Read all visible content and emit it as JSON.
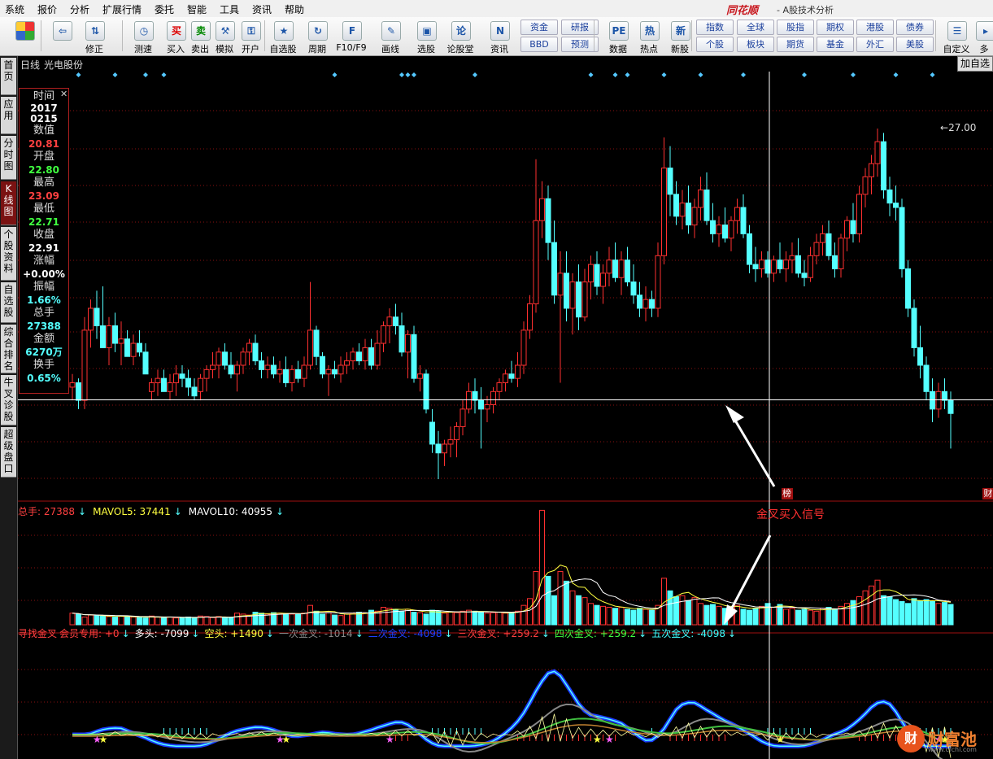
{
  "menu": [
    "系统",
    "报价",
    "分析",
    "扩展行情",
    "委托",
    "智能",
    "工具",
    "资讯",
    "帮助"
  ],
  "brand": "同花顺",
  "app_title": "- A股技术分析",
  "toolbar": {
    "buttons": [
      {
        "label": "",
        "icon": "home-icon",
        "glyph": "■"
      },
      {
        "label": "",
        "icon": "back-arrow-icon",
        "glyph": "⇦"
      },
      {
        "label": "修正",
        "icon": "updown-arrow-icon",
        "glyph": "⇅"
      },
      {
        "label": "测速",
        "icon": "clock-icon",
        "glyph": "◷"
      },
      {
        "label": "买入",
        "icon": "buy-icon",
        "glyph": "买"
      },
      {
        "label": "卖出",
        "icon": "sell-icon",
        "glyph": "卖"
      },
      {
        "label": "模拟",
        "icon": "hammer-icon",
        "glyph": "⚒"
      },
      {
        "label": "开户",
        "icon": "lock-icon",
        "glyph": "⚿"
      },
      {
        "label": "自选股",
        "icon": "star-icon",
        "glyph": "★"
      },
      {
        "label": "周期",
        "icon": "cycle-icon",
        "glyph": "↻"
      },
      {
        "label": "F10/F9",
        "icon": "f10-icon",
        "glyph": "F"
      },
      {
        "label": "画线",
        "icon": "pencil-icon",
        "glyph": "✎"
      },
      {
        "label": "选股",
        "icon": "screen-icon",
        "glyph": "▣"
      },
      {
        "label": "论股堂",
        "icon": "forum-icon",
        "glyph": "论"
      },
      {
        "label": "资讯",
        "icon": "news-icon",
        "glyph": "N"
      },
      {
        "label": "数据",
        "icon": "pe-icon",
        "glyph": "PE"
      },
      {
        "label": "热点",
        "icon": "hot-icon",
        "glyph": "热"
      },
      {
        "label": "新股",
        "icon": "ipo-icon",
        "glyph": "新"
      },
      {
        "label": "自定义",
        "icon": "custom-icon",
        "glyph": "☰"
      },
      {
        "label": "多",
        "icon": "more-icon",
        "glyph": "▸"
      }
    ],
    "small_buttons": [
      "资金",
      "BBD",
      "研报",
      "预测",
      "指数",
      "个股",
      "全球",
      "板块",
      "股指",
      "期货",
      "期权",
      "基金",
      "港股",
      "外汇",
      "债券",
      "美股"
    ]
  },
  "sidebar": [
    "首页",
    "应用",
    "分时图",
    "K线图",
    "个股资料",
    "自选股",
    "综合排名",
    "牛叉诊股",
    "超级盘口"
  ],
  "chart_header": {
    "period": "日线",
    "stock": "光电股份",
    "add_watch": "加自选"
  },
  "info_panel": [
    {
      "label": "时间",
      "value": "2017\n0215",
      "color": "#ffffff"
    },
    {
      "label": "数值",
      "value": "20.81",
      "color": "#ff4040"
    },
    {
      "label": "开盘",
      "value": "22.80",
      "color": "#40ff40"
    },
    {
      "label": "最高",
      "value": "23.09",
      "color": "#ff4040"
    },
    {
      "label": "最低",
      "value": "22.71",
      "color": "#40ff40"
    },
    {
      "label": "收盘",
      "value": "22.91",
      "color": "#ffffff"
    },
    {
      "label": "涨幅",
      "value": "+0.00%",
      "color": "#ffffff"
    },
    {
      "label": "振幅",
      "value": "1.66%",
      "color": "#54ffff"
    },
    {
      "label": "总手",
      "value": "27388",
      "color": "#54ffff"
    },
    {
      "label": "金额",
      "value": "6270万",
      "color": "#54ffff"
    },
    {
      "label": "换手",
      "value": "0.65%",
      "color": "#54ffff"
    }
  ],
  "peak_label": "27.00",
  "markers": [
    "榜",
    "财"
  ],
  "volume_legend": [
    {
      "text": "总手: 27388",
      "color": "#ff4040"
    },
    {
      "text": "MAVOL5: 37441",
      "color": "#ffff40"
    },
    {
      "text": "MAVOL10: 40955",
      "color": "#ffffff"
    }
  ],
  "indicator_legend": [
    {
      "text": "寻找金叉",
      "color": "#ff4040"
    },
    {
      "text": "会员专用: +0",
      "color": "#ff4040"
    },
    {
      "text": "多头: -7099",
      "color": "#ffffff"
    },
    {
      "text": "空头: +1490",
      "color": "#ffff40"
    },
    {
      "text": "一次金叉: -1014",
      "color": "#888888"
    },
    {
      "text": "二次金叉: -4098",
      "color": "#2040ff"
    },
    {
      "text": "三次金叉: +259.2",
      "color": "#ff4040"
    },
    {
      "text": "四次金叉: +259.2",
      "color": "#40ff40"
    },
    {
      "text": "五次金叉: -4098",
      "color": "#40ffff"
    }
  ],
  "signal_text": "金叉买入信号",
  "watermark": {
    "text": "财富池",
    "url": "www.cfchi.com",
    "glyph": "财"
  },
  "colors": {
    "up": "#ff3030",
    "down": "#54ffff",
    "bg": "#000000",
    "grid": "#8a1010"
  },
  "chart_data": {
    "type": "candlestick",
    "y_visible_range": [
      18.5,
      28.3
    ],
    "crosshair_price": 20.81,
    "crosshair_date": "20170215",
    "volume_max": 120000,
    "candles": [
      [
        21.1,
        21.4,
        20.8,
        21.2
      ],
      [
        21.2,
        21.3,
        20.6,
        20.8
      ],
      [
        20.8,
        22.7,
        20.6,
        22.4
      ],
      [
        22.4,
        23.1,
        22.0,
        22.9
      ],
      [
        22.9,
        23.3,
        22.2,
        22.5
      ],
      [
        22.5,
        23.4,
        22.1,
        22.0
      ],
      [
        22.0,
        22.7,
        21.6,
        22.5
      ],
      [
        22.5,
        22.8,
        21.9,
        22.1
      ],
      [
        22.1,
        22.6,
        21.6,
        22.2
      ],
      [
        22.2,
        22.4,
        21.8,
        21.8
      ],
      [
        21.8,
        22.3,
        21.6,
        22.1
      ],
      [
        22.1,
        22.4,
        21.8,
        21.9
      ],
      [
        21.9,
        22.1,
        21.5,
        21.4
      ],
      [
        21.0,
        21.3,
        20.8,
        21.2
      ],
      [
        21.2,
        21.5,
        20.9,
        21.3
      ],
      [
        21.3,
        21.5,
        21.0,
        21.0
      ],
      [
        21.0,
        21.4,
        20.8,
        21.2
      ],
      [
        21.2,
        21.6,
        20.9,
        21.4
      ],
      [
        21.4,
        21.6,
        21.1,
        21.3
      ],
      [
        21.3,
        21.5,
        20.9,
        21.1
      ],
      [
        21.1,
        21.3,
        20.8,
        20.9
      ],
      [
        21.0,
        21.4,
        20.8,
        21.3
      ],
      [
        21.3,
        21.6,
        21.0,
        21.5
      ],
      [
        21.5,
        21.9,
        21.3,
        21.6
      ],
      [
        21.6,
        22.0,
        21.3,
        21.9
      ],
      [
        21.9,
        22.1,
        21.5,
        21.6
      ],
      [
        21.6,
        21.9,
        21.3,
        21.4
      ],
      [
        21.4,
        21.7,
        21.0,
        21.6
      ],
      [
        21.6,
        22.0,
        21.4,
        21.9
      ],
      [
        21.9,
        22.2,
        21.6,
        22.1
      ],
      [
        22.1,
        22.3,
        21.6,
        21.7
      ],
      [
        21.7,
        21.9,
        21.3,
        21.5
      ],
      [
        21.5,
        21.8,
        21.3,
        21.6
      ],
      [
        21.6,
        21.8,
        21.3,
        21.4
      ],
      [
        21.4,
        21.7,
        21.2,
        21.5
      ],
      [
        21.5,
        21.8,
        21.1,
        21.2
      ],
      [
        21.2,
        21.6,
        21.0,
        21.5
      ],
      [
        21.5,
        21.7,
        21.2,
        21.3
      ],
      [
        21.3,
        21.8,
        21.1,
        21.6
      ],
      [
        21.6,
        23.5,
        21.5,
        22.4
      ],
      [
        22.4,
        22.5,
        21.6,
        21.8
      ],
      [
        21.8,
        21.9,
        21.3,
        21.4
      ],
      [
        21.4,
        21.6,
        20.9,
        21.5
      ],
      [
        21.5,
        21.7,
        21.3,
        21.4
      ],
      [
        21.4,
        21.8,
        21.2,
        21.6
      ],
      [
        21.6,
        21.9,
        21.4,
        21.7
      ],
      [
        21.7,
        22.0,
        21.5,
        21.9
      ],
      [
        21.9,
        22.1,
        21.6,
        21.7
      ],
      [
        21.7,
        22.2,
        21.5,
        22.0
      ],
      [
        22.0,
        22.2,
        21.5,
        21.6
      ],
      [
        21.6,
        22.4,
        21.5,
        22.1
      ],
      [
        22.1,
        22.6,
        21.9,
        22.5
      ],
      [
        22.5,
        22.9,
        22.1,
        22.7
      ],
      [
        22.7,
        23.0,
        22.3,
        22.5
      ],
      [
        22.5,
        22.8,
        21.8,
        21.9
      ],
      [
        21.9,
        22.4,
        21.3,
        22.3
      ],
      [
        22.3,
        22.5,
        21.2,
        21.3
      ],
      [
        21.3,
        21.6,
        21.0,
        21.4
      ],
      [
        21.4,
        21.5,
        20.5,
        20.6
      ],
      [
        20.3,
        20.6,
        19.6,
        19.8
      ],
      [
        19.8,
        20.1,
        19.0,
        19.6
      ],
      [
        19.6,
        19.9,
        19.3,
        19.8
      ],
      [
        19.8,
        20.2,
        19.5,
        19.9
      ],
      [
        19.9,
        20.3,
        19.5,
        20.2
      ],
      [
        20.2,
        20.8,
        20.0,
        20.6
      ],
      [
        20.6,
        21.2,
        20.5,
        21.0
      ],
      [
        21.0,
        21.3,
        20.5,
        20.8
      ],
      [
        20.8,
        21.1,
        19.7,
        20.6
      ],
      [
        20.6,
        20.9,
        20.3,
        20.7
      ],
      [
        20.7,
        21.1,
        20.5,
        21.0
      ],
      [
        21.0,
        21.3,
        20.8,
        21.2
      ],
      [
        21.2,
        21.5,
        21.0,
        21.4
      ],
      [
        21.4,
        21.7,
        21.2,
        21.3
      ],
      [
        21.3,
        21.9,
        21.1,
        21.6
      ],
      [
        21.6,
        22.6,
        21.4,
        22.4
      ],
      [
        22.4,
        23.2,
        22.2,
        23.0
      ],
      [
        23.0,
        26.3,
        22.8,
        24.9
      ],
      [
        24.9,
        25.8,
        24.5,
        25.4
      ],
      [
        25.4,
        25.7,
        24.0,
        24.4
      ],
      [
        24.4,
        24.9,
        23.0,
        23.2
      ],
      [
        23.2,
        24.2,
        21.2,
        23.7
      ],
      [
        23.7,
        24.2,
        22.6,
        22.9
      ],
      [
        22.9,
        23.7,
        22.3,
        23.5
      ],
      [
        23.5,
        23.9,
        22.4,
        22.7
      ],
      [
        22.7,
        23.8,
        22.6,
        23.5
      ],
      [
        23.5,
        24.1,
        23.1,
        23.9
      ],
      [
        23.9,
        24.2,
        23.2,
        23.4
      ],
      [
        23.4,
        23.9,
        23.0,
        23.7
      ],
      [
        23.7,
        24.3,
        23.4,
        24.0
      ],
      [
        24.0,
        24.4,
        23.5,
        23.6
      ],
      [
        23.6,
        24.2,
        23.2,
        24.0
      ],
      [
        24.0,
        24.3,
        23.4,
        23.5
      ],
      [
        23.5,
        23.9,
        23.0,
        23.2
      ],
      [
        23.2,
        23.5,
        22.7,
        22.9
      ],
      [
        22.9,
        23.4,
        22.6,
        23.1
      ],
      [
        23.1,
        23.3,
        22.7,
        22.9
      ],
      [
        22.9,
        24.4,
        22.7,
        24.1
      ],
      [
        24.1,
        26.8,
        23.9,
        26.1
      ],
      [
        26.1,
        26.6,
        25.0,
        25.5
      ],
      [
        25.5,
        25.8,
        24.8,
        25.0
      ],
      [
        25.0,
        25.6,
        24.7,
        25.3
      ],
      [
        25.3,
        25.7,
        24.6,
        24.8
      ],
      [
        24.8,
        25.4,
        24.5,
        25.2
      ],
      [
        25.2,
        25.9,
        24.9,
        25.6
      ],
      [
        25.6,
        26.0,
        24.8,
        24.9
      ],
      [
        24.9,
        25.3,
        24.4,
        24.6
      ],
      [
        24.6,
        25.0,
        24.3,
        24.8
      ],
      [
        24.8,
        25.2,
        24.4,
        24.5
      ],
      [
        24.5,
        25.0,
        24.2,
        24.9
      ],
      [
        24.9,
        25.4,
        24.6,
        25.2
      ],
      [
        25.2,
        25.5,
        24.5,
        24.6
      ],
      [
        24.6,
        24.8,
        23.7,
        23.9
      ],
      [
        23.9,
        24.3,
        23.5,
        23.8
      ],
      [
        23.8,
        24.2,
        23.6,
        24.0
      ],
      [
        24.0,
        24.2,
        23.6,
        23.7
      ],
      [
        23.7,
        24.1,
        23.5,
        24.0
      ],
      [
        24.0,
        24.4,
        23.7,
        23.8
      ],
      [
        23.8,
        24.2,
        23.5,
        24.0
      ],
      [
        24.0,
        24.4,
        23.7,
        24.1
      ],
      [
        24.1,
        24.5,
        23.6,
        23.7
      ],
      [
        23.7,
        24.0,
        23.4,
        23.6
      ],
      [
        23.6,
        24.3,
        23.5,
        24.1
      ],
      [
        24.1,
        24.6,
        23.9,
        24.4
      ],
      [
        24.4,
        24.8,
        24.1,
        24.6
      ],
      [
        24.6,
        24.9,
        24.0,
        24.1
      ],
      [
        24.1,
        24.4,
        23.6,
        23.8
      ],
      [
        23.8,
        24.6,
        23.6,
        24.5
      ],
      [
        24.5,
        25.0,
        24.2,
        24.9
      ],
      [
        24.9,
        25.3,
        24.4,
        24.6
      ],
      [
        24.6,
        25.7,
        24.4,
        25.5
      ],
      [
        25.5,
        26.1,
        25.2,
        25.9
      ],
      [
        25.9,
        26.4,
        25.5,
        26.2
      ],
      [
        26.2,
        27.0,
        25.9,
        26.7
      ],
      [
        26.7,
        26.9,
        25.4,
        25.6
      ],
      [
        25.6,
        25.9,
        25.0,
        25.3
      ],
      [
        25.3,
        25.7,
        24.9,
        25.2
      ],
      [
        25.2,
        25.4,
        23.6,
        23.8
      ],
      [
        23.8,
        24.0,
        22.7,
        22.9
      ],
      [
        22.9,
        23.1,
        21.8,
        22.0
      ],
      [
        22.0,
        22.5,
        21.3,
        21.6
      ],
      [
        21.6,
        21.8,
        20.8,
        21.0
      ],
      [
        21.0,
        21.3,
        20.3,
        20.6
      ],
      [
        20.6,
        21.2,
        20.4,
        21.0
      ],
      [
        21.0,
        21.3,
        20.6,
        20.8
      ],
      [
        20.8,
        21.0,
        19.7,
        20.5
      ]
    ],
    "volume": [
      12000,
      11000,
      8000,
      10000,
      9500,
      9000,
      8500,
      8000,
      9000,
      8500,
      8000,
      7500,
      7000,
      9000,
      8000,
      7500,
      8000,
      7000,
      7500,
      8000,
      7000,
      9000,
      8500,
      7500,
      8500,
      7000,
      7500,
      12000,
      11000,
      10000,
      13000,
      12000,
      11000,
      12500,
      12000,
      11500,
      11000,
      10500,
      12000,
      20000,
      14000,
      11000,
      12500,
      10000,
      9500,
      11000,
      12000,
      13000,
      12000,
      15000,
      14000,
      18000,
      17000,
      16000,
      14000,
      16000,
      13000,
      12500,
      11000,
      15000,
      14000,
      12000,
      13000,
      12500,
      14000,
      15000,
      14000,
      13000,
      12000,
      12500,
      13000,
      12000,
      12500,
      14000,
      20000,
      27000,
      55000,
      118000,
      50000,
      30000,
      55000,
      45000,
      35000,
      30000,
      28000,
      22000,
      20000,
      19000,
      18000,
      17000,
      18000,
      16000,
      15000,
      17000,
      16000,
      15000,
      20000,
      48000,
      35000,
      29000,
      30000,
      25000,
      28000,
      22000,
      20000,
      21000,
      19000,
      17000,
      18000,
      20000,
      16000,
      15000,
      17000,
      19000,
      22000,
      18000,
      21000,
      16000,
      17000,
      15000,
      16000,
      15000,
      14000,
      17000,
      18000,
      16000,
      19000,
      22000,
      25000,
      29000,
      35000,
      40000,
      46000,
      30000,
      29000,
      26000,
      24000,
      22000,
      27000,
      25000,
      26000,
      24000,
      22000,
      23000,
      21000
    ],
    "volume_up": [
      1,
      0,
      1,
      1,
      0,
      0,
      1,
      0,
      1,
      0,
      1,
      0,
      0,
      1,
      1,
      0,
      1,
      1,
      0,
      0,
      0,
      1,
      1,
      1,
      1,
      0,
      0,
      1,
      1,
      1,
      0,
      0,
      1,
      0,
      1,
      0,
      1,
      0,
      1,
      1,
      0,
      0,
      1,
      0,
      1,
      1,
      1,
      0,
      1,
      0,
      1,
      1,
      1,
      0,
      0,
      1,
      0,
      1,
      0,
      0,
      0,
      1,
      1,
      1,
      1,
      1,
      0,
      0,
      1,
      1,
      1,
      1,
      0,
      1,
      1,
      1,
      1,
      1,
      0,
      0,
      1,
      0,
      1,
      0,
      1,
      1,
      0,
      1,
      1,
      0,
      1,
      0,
      0,
      0,
      1,
      0,
      1,
      1,
      0,
      0,
      1,
      0,
      1,
      1,
      0,
      0,
      1,
      0,
      1,
      1,
      0,
      0,
      0,
      1,
      0,
      1,
      0,
      1,
      1,
      0,
      0,
      1,
      1,
      1,
      0,
      0,
      1,
      1,
      0,
      1,
      1,
      1,
      1,
      0,
      0,
      0,
      0,
      0,
      0,
      0,
      0,
      0,
      1,
      0,
      0
    ],
    "signals_diamond_index": [
      1,
      7,
      12,
      15,
      43,
      54,
      55,
      56,
      66,
      85,
      89,
      91,
      97,
      103,
      110,
      120,
      128,
      135,
      141
    ],
    "marker_index": {
      "bang": 117,
      "cai": 150
    }
  }
}
